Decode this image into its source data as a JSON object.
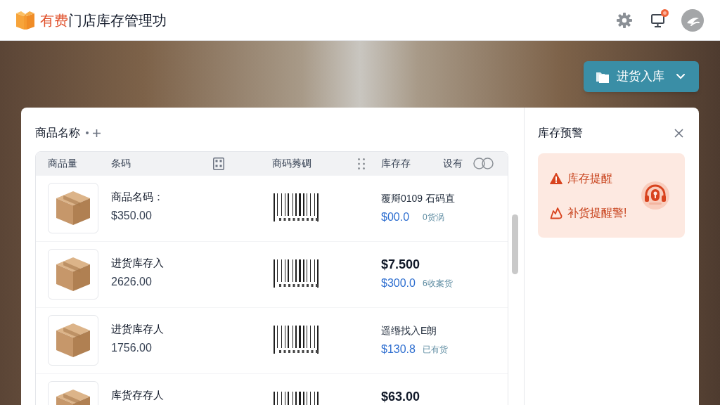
{
  "header": {
    "logo_accent": "有费",
    "title": "门店库存管理功",
    "notification": true
  },
  "stock_in_button": {
    "label": "进货入库"
  },
  "product_panel": {
    "title": "商品名称",
    "columns": [
      "商品量",
      "条码",
      "商码莠碉",
      "库存存",
      "设有"
    ],
    "rows": [
      {
        "name": "商品名码：",
        "price": "$350.00",
        "detail": {
          "kind": "note",
          "text": "覆搿0109 石码直"
        },
        "amount": "$00.0",
        "status": "0货涡"
      },
      {
        "name": "进货库存入",
        "price": "2626.00",
        "detail": {
          "kind": "price",
          "text": "$7.500"
        },
        "amount": "$300.0",
        "status": "6收案货"
      },
      {
        "name": "进货库存人",
        "price": "1756.00",
        "detail": {
          "kind": "note",
          "text": "遥缗找入E朗"
        },
        "amount": "$130.8",
        "status": "已有货"
      },
      {
        "name": "库货存存人",
        "detail": {
          "kind": "price",
          "text": "$63.00"
        }
      }
    ]
  },
  "alert_panel": {
    "title": "库存预警",
    "items": [
      {
        "kind": "warning",
        "label": "库存提醒"
      },
      {
        "kind": "restock",
        "label": "补货提醒警!"
      }
    ]
  }
}
